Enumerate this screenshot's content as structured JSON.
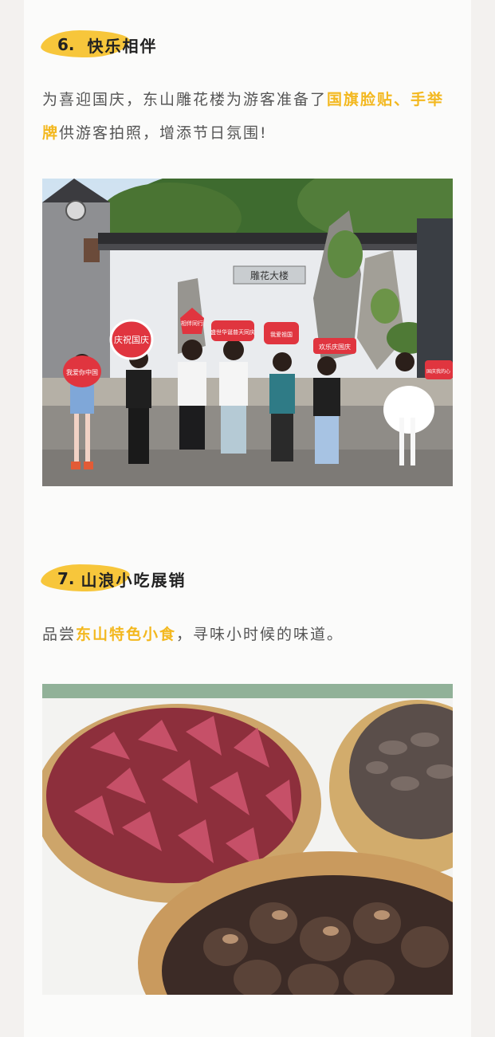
{
  "sections": [
    {
      "number": "6.",
      "title": "快乐相伴",
      "para_parts": [
        "为喜迎国庆，东山雕花楼为游客准备了",
        "国旗脸贴、手举牌",
        "供游客拍照，增添节日氛围!"
      ],
      "photo_signs": [
        "庆祝国庆",
        "相伴同行",
        "盛世华诞普天同庆",
        "我爱祖国",
        "国庆我的心",
        "欢乐庆国庆",
        "我爱你中国"
      ],
      "photo_plaque": "雕花大楼"
    },
    {
      "number": "7.",
      "title": "山浪小吃展销",
      "para_parts": [
        "品尝",
        "东山特色小食",
        "，寻味小时候的味道。"
      ]
    }
  ],
  "colors": {
    "accent": "#f3b81f",
    "brush": "#f7c63b",
    "text": "#555555"
  }
}
